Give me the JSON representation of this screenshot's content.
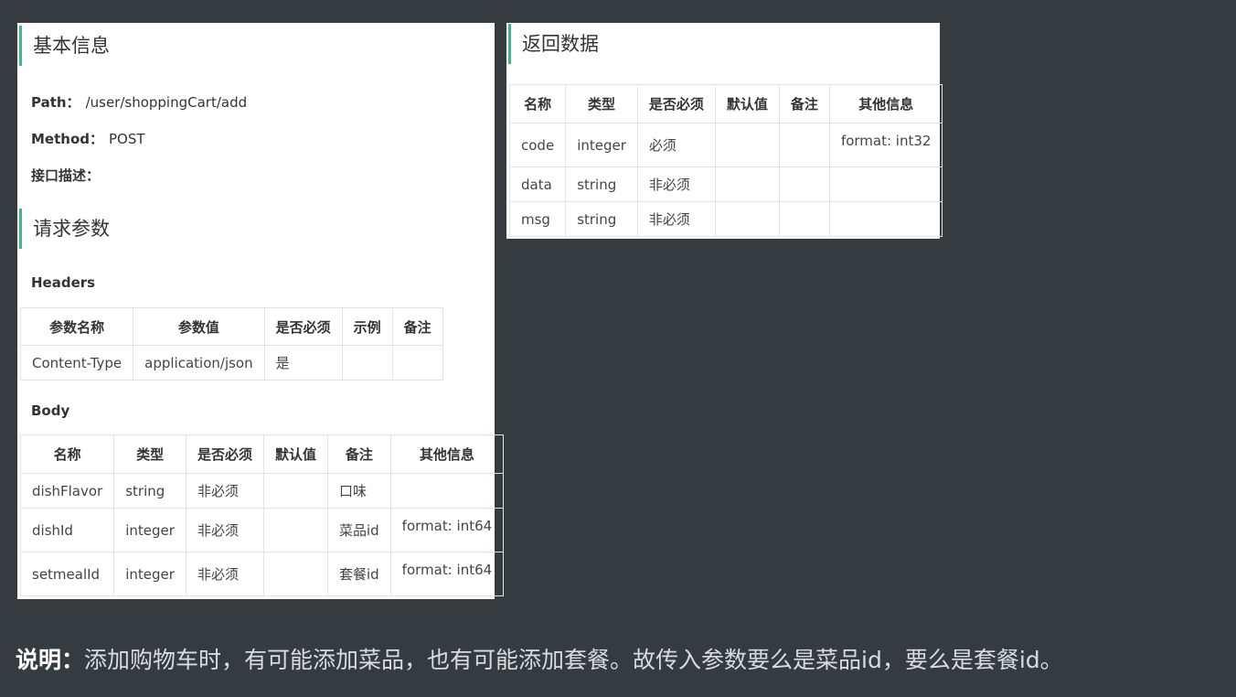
{
  "basic": {
    "title": "基本信息",
    "path_label": "Path：",
    "path_value": "/user/shoppingCart/add",
    "method_label": "Method：",
    "method_value": "POST",
    "desc_label": "接口描述："
  },
  "request": {
    "title": "请求参数",
    "headers_label": "Headers",
    "headers_columns": [
      "参数名称",
      "参数值",
      "是否必须",
      "示例",
      "备注"
    ],
    "headers_rows": [
      [
        "Content-Type",
        "application/json",
        "是",
        "",
        ""
      ]
    ],
    "body_label": "Body",
    "body_columns": [
      "名称",
      "类型",
      "是否必须",
      "默认值",
      "备注",
      "其他信息"
    ],
    "body_rows": [
      [
        "dishFlavor",
        "string",
        "非必须",
        "",
        "口味",
        ""
      ],
      [
        "dishId",
        "integer",
        "非必须",
        "",
        "菜品id",
        "format: int64"
      ],
      [
        "setmealId",
        "integer",
        "非必须",
        "",
        "套餐id",
        "format: int64"
      ]
    ]
  },
  "response": {
    "title": "返回数据",
    "columns": [
      "名称",
      "类型",
      "是否必须",
      "默认值",
      "备注",
      "其他信息"
    ],
    "rows": [
      [
        "code",
        "integer",
        "必须",
        "",
        "",
        "format: int32"
      ],
      [
        "data",
        "string",
        "非必须",
        "",
        "",
        ""
      ],
      [
        "msg",
        "string",
        "非必须",
        "",
        "",
        ""
      ]
    ]
  },
  "note": {
    "label": "说明：",
    "text": "添加购物车时，有可能添加菜品，也有可能添加套餐。故传入参数要么是菜品id，要么是套餐id。"
  },
  "colors": {
    "accent": "#3eb88a",
    "background": "#363b40"
  }
}
